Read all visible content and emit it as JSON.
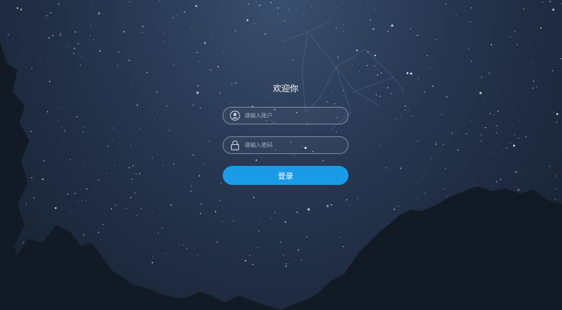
{
  "login": {
    "title": "欢迎你",
    "username": {
      "placeholder": "请输入账户",
      "value": "",
      "icon": "user-icon"
    },
    "password": {
      "placeholder": "请输入密码",
      "value": "",
      "icon": "lock-icon"
    },
    "submit_label": "登录"
  },
  "colors": {
    "button": "#1a9be8",
    "sky_top": "#3a4f6e",
    "sky_bottom": "#17212f",
    "trees": "#121b25"
  }
}
